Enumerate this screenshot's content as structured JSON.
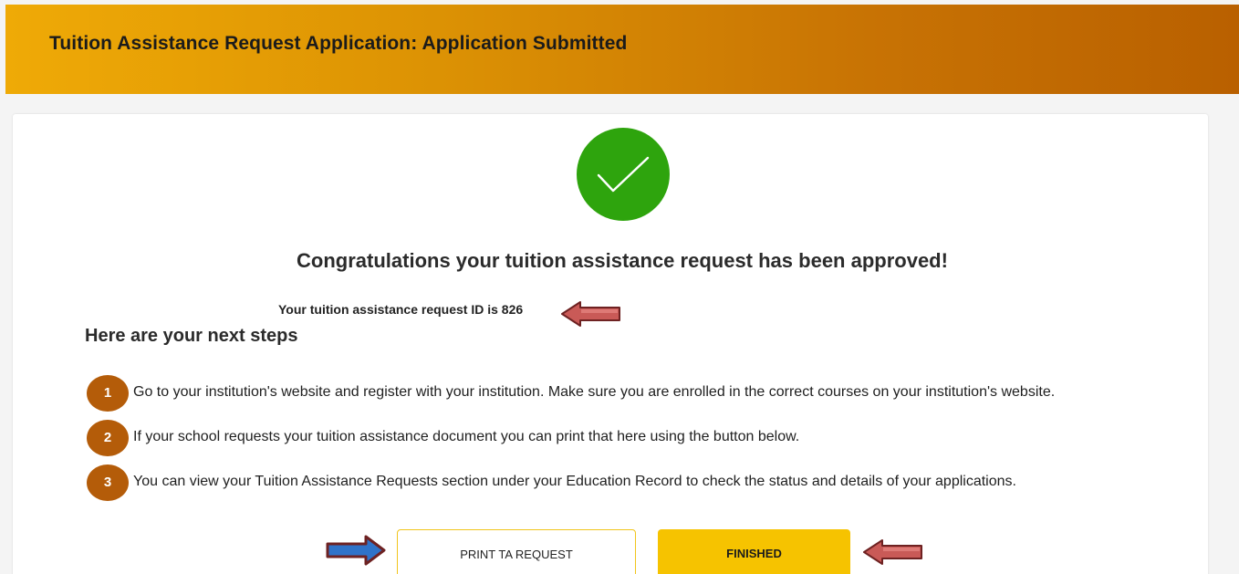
{
  "header": {
    "title": "Tuition Assistance Request Application: Application Submitted"
  },
  "status": {
    "icon": "checkmark-icon",
    "color": "#2ea40d",
    "message": "Congratulations your tuition assistance request has been approved!",
    "request_id_text": "Your tuition assistance request ID is 826"
  },
  "next_steps": {
    "heading": "Here are your next steps",
    "steps": [
      {
        "number": "1",
        "text": "Go to your institution's website and register with your institution. Make sure you are enrolled in the correct courses on your institution's website."
      },
      {
        "number": "2",
        "text": "If your school requests your tuition assistance document you can print that here using the button below."
      },
      {
        "number": "3",
        "text": "You can view your Tuition Assistance Requests section under your Education Record to check the status and details of your applications."
      }
    ]
  },
  "actions": {
    "print_label": "PRINT TA REQUEST",
    "finished_label": "FINISHED"
  },
  "colors": {
    "header_start": "#efaa06",
    "header_end": "#b96000",
    "step_badge": "#b45c09",
    "finished_button": "#f6c300",
    "print_border": "#f1c51c",
    "annotation_arrow_red": "#c0504d",
    "annotation_arrow_blue": "#2f73c9"
  }
}
